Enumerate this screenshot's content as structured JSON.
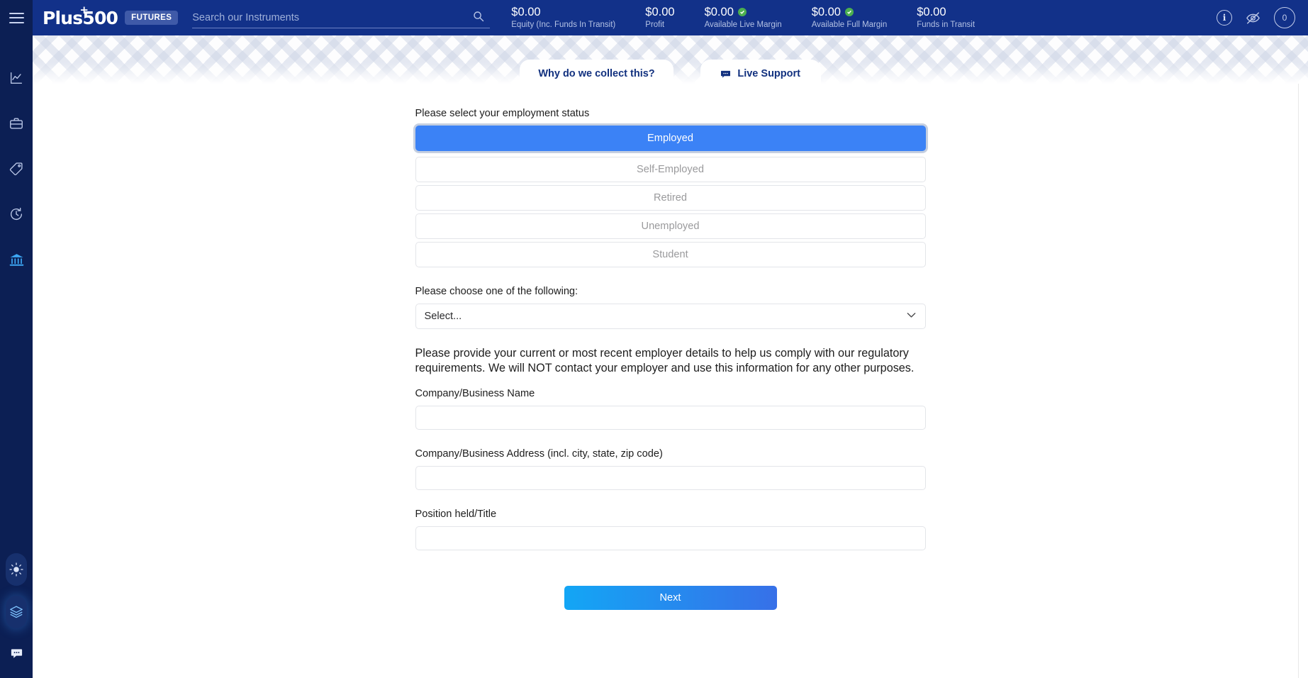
{
  "topbar": {
    "menu_icon": "hamburger-icon",
    "brand": "Plus500",
    "brand_badge": "FUTURES",
    "search": {
      "placeholder": "Search our Instruments",
      "value": "",
      "icon": "search-icon"
    },
    "metrics": [
      {
        "value": "$0.00",
        "label": "Equity (Inc. Funds In Transit)",
        "has_check": false
      },
      {
        "value": "$0.00",
        "label": "Profit",
        "has_check": false
      },
      {
        "value": "$0.00",
        "label": "Available Live Margin",
        "has_check": true
      },
      {
        "value": "$0.00",
        "label": "Available Full Margin",
        "has_check": true
      },
      {
        "value": "$0.00",
        "label": "Funds in Transit",
        "has_check": false
      }
    ],
    "actions": {
      "info_label": "i",
      "info_icon": "info-circle-icon",
      "hide_icon": "eye-off-icon",
      "count": "0"
    },
    "colors": {
      "bar": "#123189",
      "rail": "#0c1f54",
      "check": "#4caf50"
    }
  },
  "sidebar": {
    "items": [
      {
        "name": "chart-icon",
        "label": "Charts",
        "active": false
      },
      {
        "name": "briefcase-icon",
        "label": "Portfolio",
        "active": false
      },
      {
        "name": "tag-icon",
        "label": "Instruments",
        "active": false
      },
      {
        "name": "pending-orders-icon",
        "label": "Pending Orders",
        "active": false
      },
      {
        "name": "bank-icon",
        "label": "Funds Management",
        "active": true
      }
    ],
    "bottom_items": [
      {
        "name": "brightness-icon",
        "label": "Theme"
      },
      {
        "name": "layers-icon",
        "label": "Layouts"
      },
      {
        "name": "chat-icon",
        "label": "Chat"
      }
    ],
    "active_color": "#3da8f5"
  },
  "tabs": [
    {
      "label": "Why do we collect this?",
      "icon": null
    },
    {
      "label": "Live Support",
      "icon": "chat-bubble-icon"
    }
  ],
  "form": {
    "employment_question": "Please select your employment status",
    "employment_options": [
      {
        "label": "Employed",
        "selected": true
      },
      {
        "label": "Self-Employed",
        "selected": false
      },
      {
        "label": "Retired",
        "selected": false
      },
      {
        "label": "Unemployed",
        "selected": false
      },
      {
        "label": "Student",
        "selected": false
      }
    ],
    "choose_question": "Please choose one of the following:",
    "select_value": "Select...",
    "disclaimer": "Please provide your current or most recent employer details to help us comply with our regulatory requirements. We will NOT contact your employer and use this information for any other purposes.",
    "fields": [
      {
        "label": "Company/Business Name",
        "value": "",
        "placeholder": ""
      },
      {
        "label": "Company/Business Address (incl. city, state, zip code)",
        "value": "",
        "placeholder": ""
      },
      {
        "label": "Position held/Title",
        "value": "",
        "placeholder": ""
      }
    ],
    "next_label": "Next",
    "accent": "#3b82f6"
  }
}
